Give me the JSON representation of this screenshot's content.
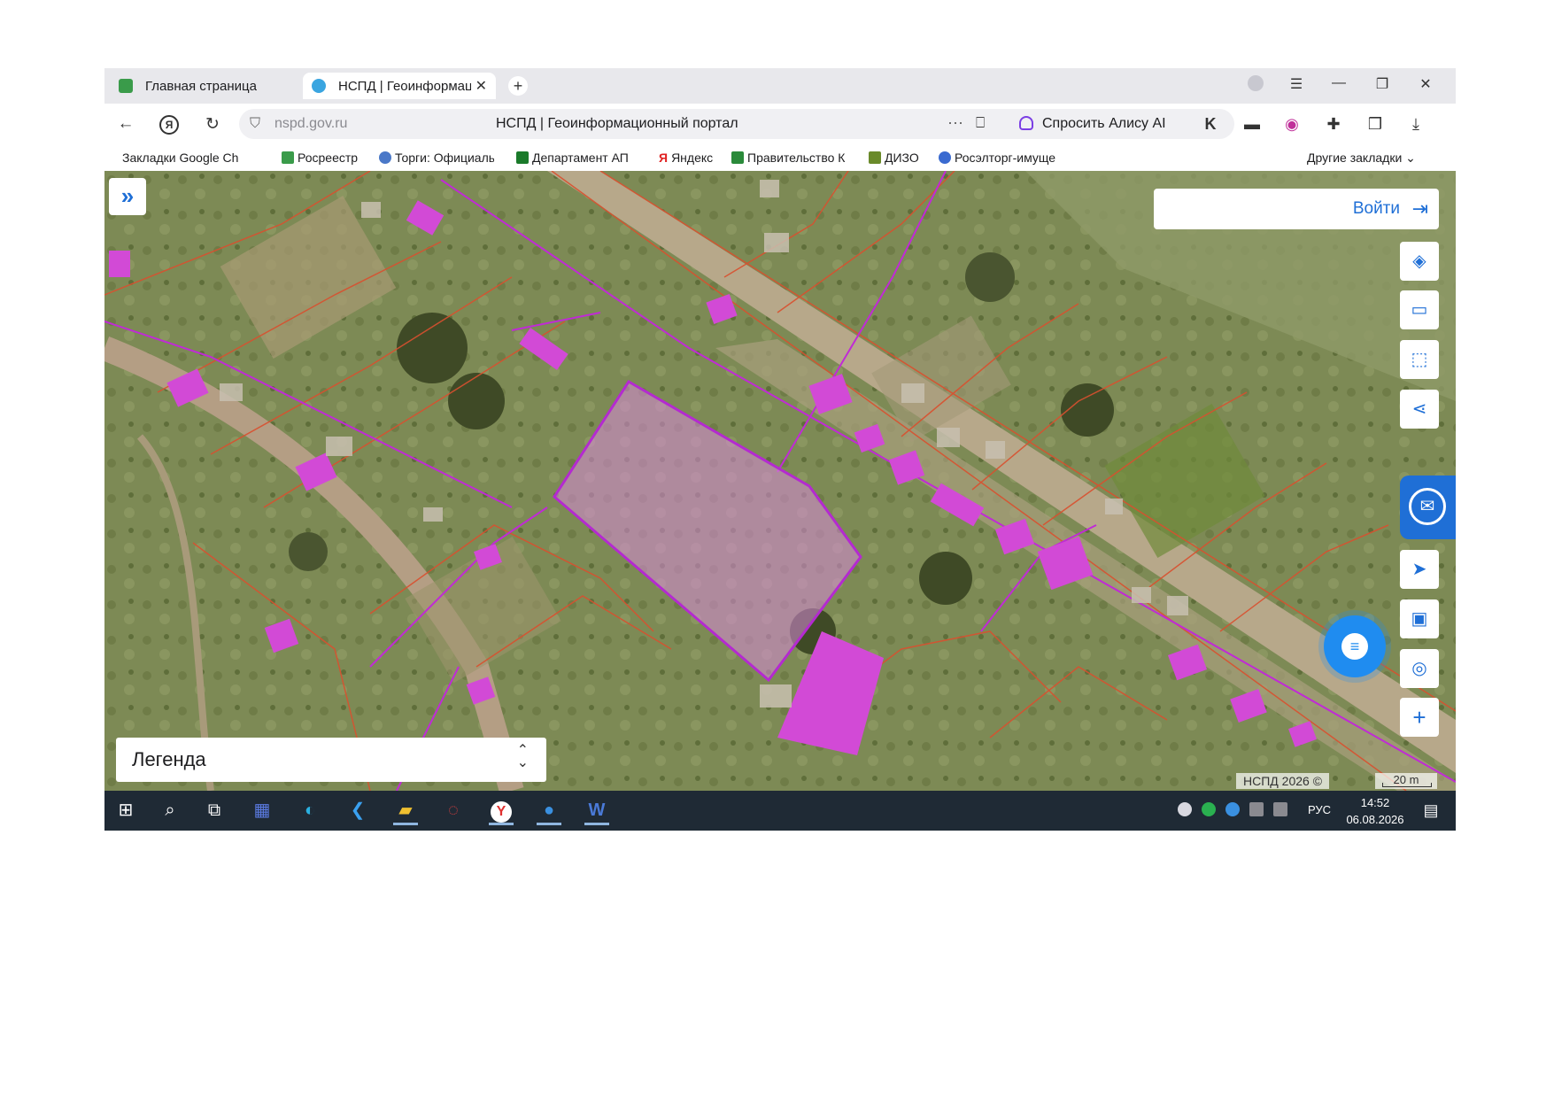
{
  "browser": {
    "tabs": [
      {
        "label": "Главная страница"
      },
      {
        "label": "НСПД | Геоинформаци"
      }
    ],
    "new_tab": "+",
    "url": "nspd.gov.ru",
    "page_title": "НСПД | Геоинформационный портал",
    "alice_label": "Спросить Алису AI",
    "bookmarks": [
      {
        "label": "Закладки Google Ch"
      },
      {
        "label": "Росреестр"
      },
      {
        "label": "Торги: Официаль"
      },
      {
        "label": "Департамент АП"
      },
      {
        "label": "Яндекс"
      },
      {
        "label": "Правительство К"
      },
      {
        "label": "ДИЗО"
      },
      {
        "label": "Росэлторг-имуще"
      }
    ],
    "other_bookmarks": "Другие закладки"
  },
  "map": {
    "login_label": "Войти",
    "legend_label": "Легенда",
    "attribution": "НСПД 2026 ©",
    "scale_label": "20 m"
  },
  "taskbar": {
    "language": "РУС",
    "time": "14:52",
    "date": "06.08.2026"
  },
  "colors": {
    "accent": "#1f6fd6",
    "parcel_outline": "#c02ad6",
    "parcel_fill": "#d88ad8",
    "boundary": "#d9502f",
    "building": "#d24ad6",
    "taskbar": "#1f2a35"
  },
  "icons": [
    "back-icon",
    "yandex-icon",
    "reload-icon",
    "shield-icon",
    "more-icon",
    "bookmark-icon",
    "layers-icon",
    "ruler-icon",
    "select-area-icon",
    "share-icon",
    "chat-icon",
    "locate-icon",
    "picture-icon",
    "search-location-icon",
    "zoom-in-icon",
    "login-icon",
    "windows-start-icon",
    "search-icon",
    "task-view-icon"
  ]
}
